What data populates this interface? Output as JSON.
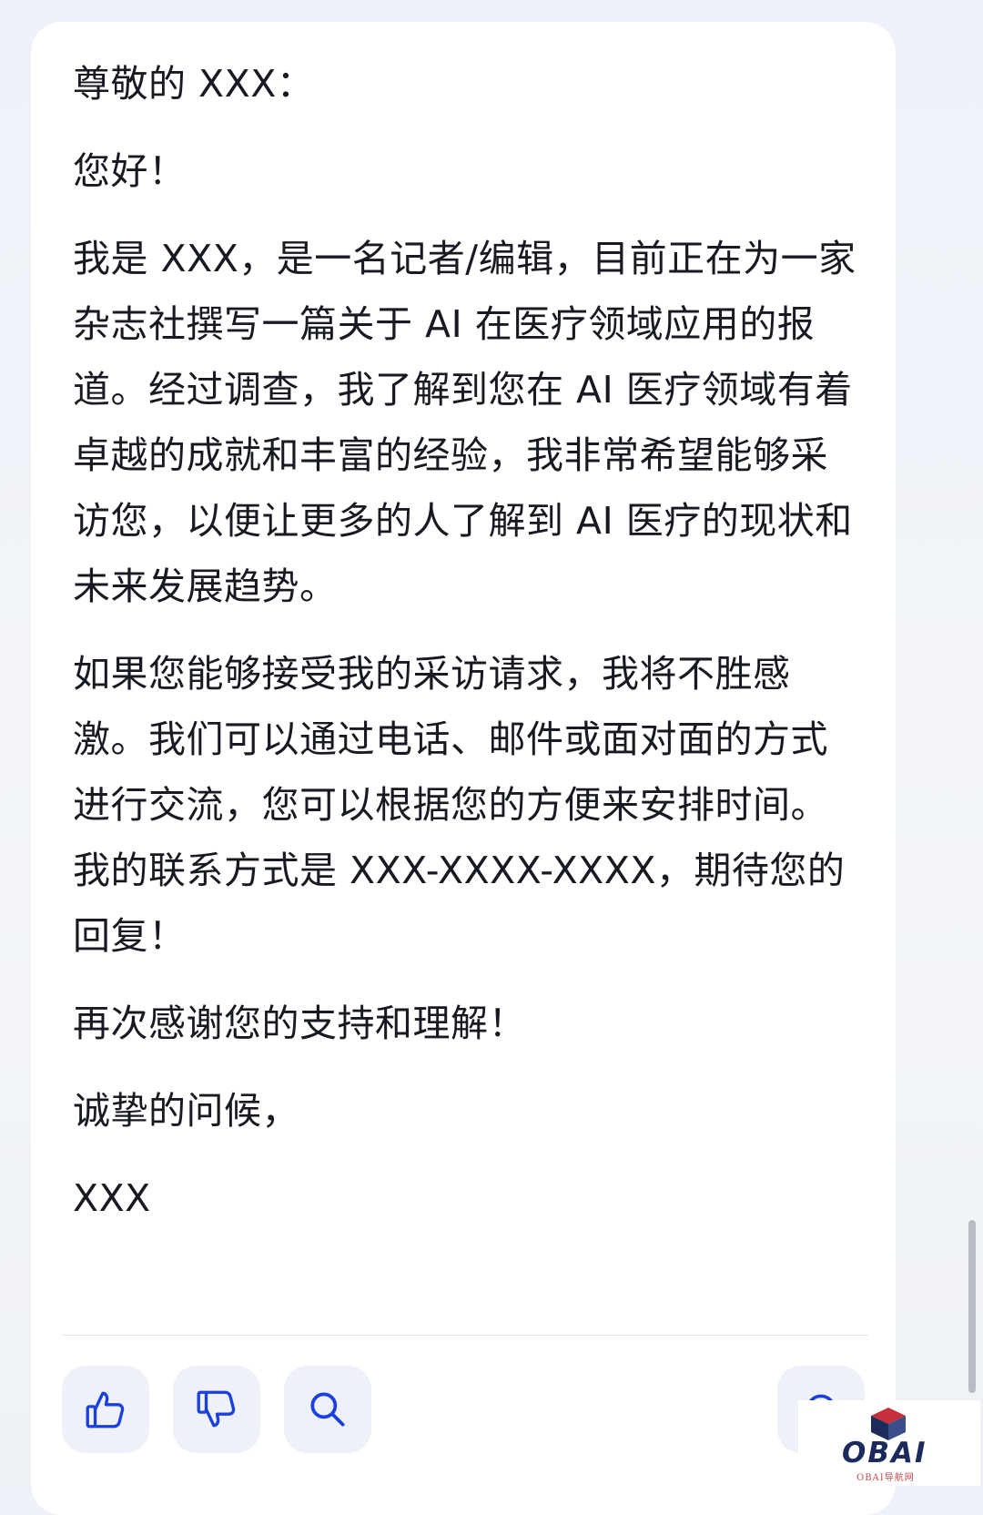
{
  "message": {
    "paragraphs": [
      "尊敬的 XXX：",
      "您好！",
      "我是 XXX，是一名记者/编辑，目前正在为一家杂志社撰写一篇关于 AI 在医疗领域应用的报道。经过调查，我了解到您在 AI 医疗领域有着卓越的成就和丰富的经验，我非常希望能够采访您，以便让更多的人了解到 AI 医疗的现状和未来发展趋势。",
      "如果您能够接受我的采访请求，我将不胜感激。我们可以通过电话、邮件或面对面的方式进行交流，您可以根据您的方便来安排时间。我的联系方式是 XXX-XXXX-XXXX，期待您的回复！",
      "再次感谢您的支持和理解！",
      "诚挚的问候，",
      "XXX"
    ]
  },
  "actions": [
    {
      "name": "like",
      "icon": "thumbs-up-icon"
    },
    {
      "name": "dislike",
      "icon": "thumbs-down-icon"
    },
    {
      "name": "search",
      "icon": "search-icon"
    },
    {
      "name": "regenerate",
      "icon": "refresh-icon"
    }
  ],
  "colors": {
    "accent": "#1a3fe0",
    "text": "#171a22",
    "button_bg": "#eef1f7"
  },
  "watermark": {
    "brand": "OBAI",
    "subtitle": "OBAI导航网",
    "icon": "cube-logo"
  }
}
